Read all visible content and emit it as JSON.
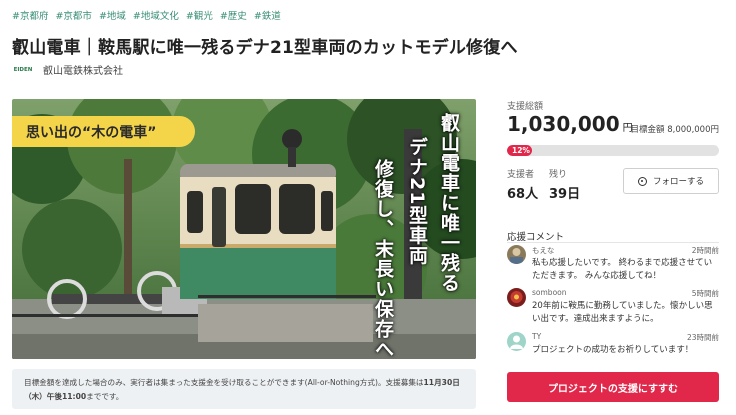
{
  "tags": [
    "#京都府",
    "#京都市",
    "#地域",
    "#地域文化",
    "#観光",
    "#歴史",
    "#鉄道"
  ],
  "title": "叡山電車｜鞍馬駅に唯一残るデナ21型車両のカットモデル修復へ",
  "organization": {
    "logo_text": "EIDEN",
    "name": "叡山電鉄株式会社"
  },
  "hero": {
    "badge": "思い出の“木の電車”",
    "overlay_lines": [
      "叡山電車に唯一残る",
      "デナ21型車両",
      "修復し、末長い保存へ"
    ]
  },
  "notice": {
    "text_before": "目標金額を達成した場合のみ、実行者は集まった支援金を受け取ることができます(All-or-Nothing方式)。支援募集は",
    "deadline": "11月30日（木）午後11:00",
    "text_after": "までです。"
  },
  "funding": {
    "raised_label": "支援総額",
    "raised_amount": "1,030,000",
    "currency": "円",
    "goal_text": "目標金額 8,000,000円",
    "progress_percent": 12,
    "progress_label": "12%",
    "supporters_label": "支援者",
    "supporters_value": "68人",
    "remaining_label": "残り",
    "remaining_value": "39日",
    "follow_label": "フォローする"
  },
  "comments_title": "応援コメント",
  "comments": [
    {
      "name": "もえな",
      "time": "2時間前",
      "text": "私も応援したいです。 終わるまで応援させていただきます。 みんな応援してね！",
      "avatar": "photo"
    },
    {
      "name": "somboon",
      "time": "5時間前",
      "text": "20年前に鞍馬に勤務していました。懐かしい思い出です。達成出来ますように。",
      "avatar": "photo"
    },
    {
      "name": "TY",
      "time": "23時間前",
      "text": "プロジェクトの成功をお祈りしています！",
      "avatar": "default"
    }
  ],
  "cta_label": "プロジェクトの支援にすすむ",
  "colors": {
    "accent": "#e1284b",
    "tag": "#3b8f77",
    "badge": "#f4d54a"
  }
}
